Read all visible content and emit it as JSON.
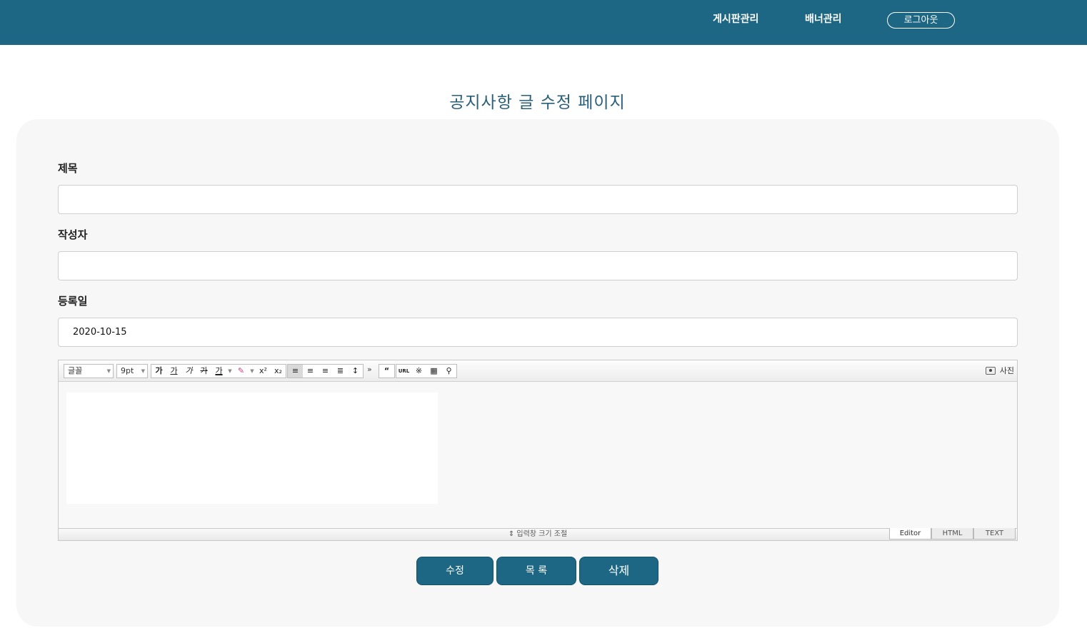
{
  "header": {
    "nav_board": "게시판관리",
    "nav_banner": "배너관리",
    "logout": "로그아웃"
  },
  "page": {
    "title": "공지사항 글 수정 페이지"
  },
  "form": {
    "title_label": "제목",
    "title_value": "",
    "writer_label": "작성자",
    "writer_value": "",
    "date_label": "등록일",
    "date_value": "2020-10-15"
  },
  "editor": {
    "font_select": "글꼴",
    "size_select": "9pt",
    "photo_label": "사진",
    "resize_label": "⇕ 입력창 크기 조절",
    "modes": [
      "Editor",
      "HTML",
      "TEXT"
    ],
    "format_buttons": [
      "가",
      "가",
      "가",
      "가",
      "가"
    ],
    "more": "»"
  },
  "actions": {
    "edit": "수정",
    "list": "목 록",
    "delete": "삭제"
  }
}
